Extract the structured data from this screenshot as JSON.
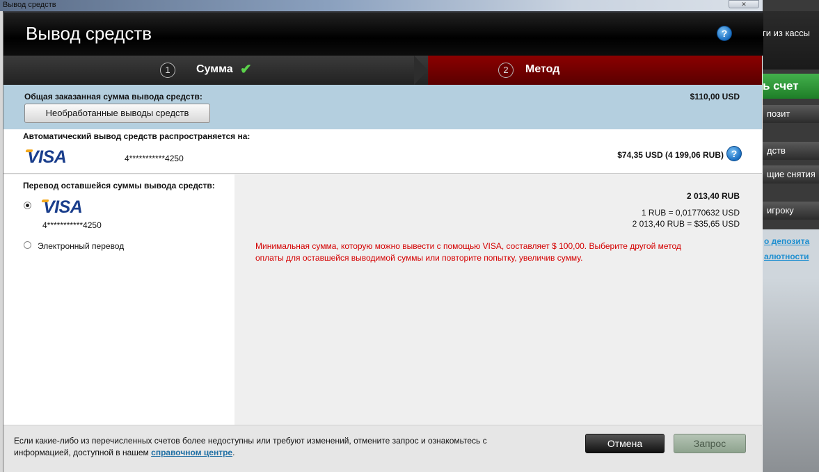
{
  "window": {
    "title": "Вывод средств"
  },
  "dialog": {
    "title": "Вывод средств"
  },
  "steps": [
    {
      "number": "1",
      "label": "Сумма",
      "done": true
    },
    {
      "number": "2",
      "label": "Метод",
      "active": true
    }
  ],
  "total": {
    "label": "Общая заказанная сумма вывода средств:",
    "amount": "$110,00 USD",
    "button": "Необработанные выводы средств"
  },
  "auto": {
    "label": "Автоматический вывод средств распространяется на:",
    "card_brand": "VISA",
    "card_number": "4***********4250",
    "amount": "$74,35 USD (4 199,06 RUB)"
  },
  "remaining": {
    "label": "Перевод оставшейся суммы вывода средств:",
    "options": [
      {
        "type": "visa",
        "brand": "VISA",
        "card_number": "4***********4250",
        "selected": true
      },
      {
        "type": "text",
        "label": "Электронный перевод",
        "selected": false
      }
    ],
    "amount": "2 013,40 RUB",
    "rate": "1 RUB = 0,01770632 USD",
    "converted": "2 013,40 RUB = $35,65 USD",
    "error_line1": "Минимальная сумма, которую можно вывести с помощью VISA, составляет $ 100,00. Выберите другой метод",
    "error_line2": "оплаты для оставшейся выводимой суммы или повторите попытку, увеличив сумму."
  },
  "footer": {
    "text_line1": "Если какие-либо из перечисленных счетов более недоступны или требуют изменений, отмените запрос и ознакомьтесь с",
    "text_line2_before": "информацией, доступной в нашем ",
    "link": "справочном центре",
    "text_line2_after": ".",
    "cancel": "Отмена",
    "submit": "Запрос"
  },
  "background": {
    "right_items": [
      "ги из кассы",
      "ь счет",
      "позит",
      "дств",
      "щие снятия",
      "игроку",
      "о депозита",
      "алютности"
    ]
  },
  "colors": {
    "error": "#d40000",
    "step_active_bg": "#8b0000",
    "check": "#5bd24b",
    "link": "#1f6fa4"
  },
  "icons": {
    "help": "question-mark-circle",
    "check": "checkmark"
  }
}
